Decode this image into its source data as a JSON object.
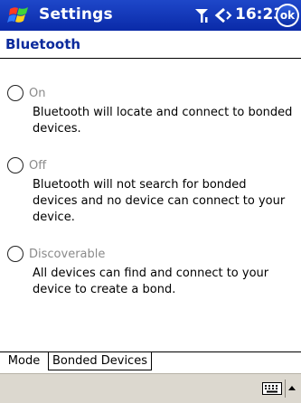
{
  "titlebar": {
    "title": "Settings",
    "clock": "16:23",
    "ok_label": "ok"
  },
  "page": {
    "heading": "Bluetooth"
  },
  "options": [
    {
      "label": "On",
      "description": "Bluetooth will locate and connect to bonded devices.",
      "selected": false
    },
    {
      "label": "Off",
      "description": "Bluetooth will not search for bonded devices and no device can connect to your device.",
      "selected": false
    },
    {
      "label": "Discoverable",
      "description": "All devices can find and connect to your device to create a bond.",
      "selected": false
    }
  ],
  "tabs": [
    {
      "label": "Mode",
      "active": true
    },
    {
      "label": "Bonded Devices",
      "active": false
    }
  ],
  "icons": {
    "start": "windows-flag-icon",
    "signal": "signal-strength-icon",
    "volume": "volume-icon",
    "keyboard": "keyboard-icon",
    "input_menu": "up-arrow-icon"
  },
  "colors": {
    "titlebar": "#0a2aa8",
    "heading": "#0b2a9c",
    "menubar": "#dcd8cf"
  }
}
